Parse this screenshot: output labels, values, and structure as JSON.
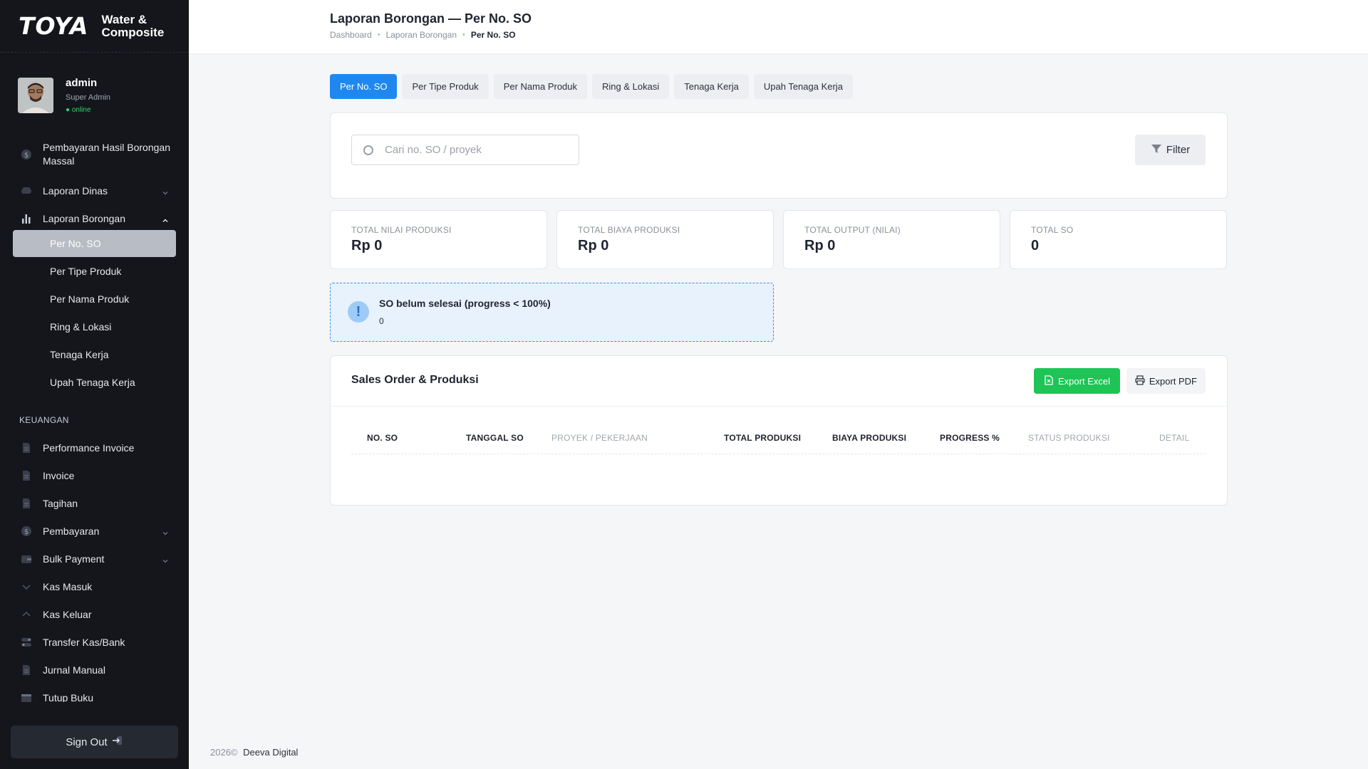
{
  "brand": {
    "logo": "TOYA",
    "subtitle_line1": "Water &",
    "subtitle_line2": "Composite"
  },
  "user": {
    "name": "admin",
    "role": "Super Admin",
    "status": "● online"
  },
  "sidebar": {
    "items": [
      {
        "label_line1": "Pembayaran Hasil Borongan",
        "label_line2": "Massal",
        "icon": "dollar-icon"
      },
      {
        "label": "Laporan Dinas",
        "icon": "car-icon",
        "chevron": "down"
      },
      {
        "label": "Laporan Borongan",
        "icon": "bar-chart-icon",
        "chevron": "up"
      }
    ],
    "sub_items": [
      "Per No. SO",
      "Per Tipe Produk",
      "Per Nama Produk",
      "Ring & Lokasi",
      "Tenaga Kerja",
      "Upah Tenaga Kerja"
    ],
    "section": "KEUANGAN",
    "finance_items": [
      {
        "label": "Performance Invoice",
        "icon": "document-icon"
      },
      {
        "label": "Invoice",
        "icon": "document-icon"
      },
      {
        "label": "Tagihan",
        "icon": "document-icon"
      },
      {
        "label": "Pembayaran",
        "icon": "dollar-icon",
        "chevron": "down"
      },
      {
        "label": "Bulk Payment",
        "icon": "wallet-icon",
        "chevron": "down"
      },
      {
        "label": "Kas Masuk",
        "icon": "arrow-down-icon"
      },
      {
        "label": "Kas Keluar",
        "icon": "arrow-up-icon"
      },
      {
        "label": "Transfer Kas/Bank",
        "icon": "transfer-icon"
      },
      {
        "label": "Jurnal Manual",
        "icon": "document-icon"
      },
      {
        "label": "Tutup Buku",
        "icon": "calendar-icon"
      }
    ],
    "signout": "Sign Out"
  },
  "header": {
    "title": "Laporan Borongan — Per No. SO",
    "breadcrumb": [
      "Dashboard",
      "Laporan Borongan",
      "Per No. SO"
    ]
  },
  "tabs": [
    "Per No. SO",
    "Per Tipe Produk",
    "Per Nama Produk",
    "Ring & Lokasi",
    "Tenaga Kerja",
    "Upah Tenaga Kerja"
  ],
  "search": {
    "placeholder": "Cari no. SO / proyek",
    "value": ""
  },
  "filter_label": "Filter",
  "stats": [
    {
      "label": "TOTAL NILAI PRODUKSI",
      "value": "Rp 0"
    },
    {
      "label": "TOTAL BIAYA PRODUKSI",
      "value": "Rp 0"
    },
    {
      "label": "TOTAL OUTPUT (NILAI)",
      "value": "Rp 0"
    },
    {
      "label": "TOTAL SO",
      "value": "0"
    }
  ],
  "alert": {
    "title": "SO belum selesai (progress < 100%)",
    "value": "0"
  },
  "table": {
    "title": "Sales Order & Produksi",
    "export_excel": "Export Excel",
    "export_pdf": "Export PDF",
    "columns": [
      "NO. SO",
      "TANGGAL SO",
      "PROYEK / PEKERJAAN",
      "TOTAL PRODUKSI",
      "BIAYA PRODUKSI",
      "PROGRESS %",
      "STATUS PRODUKSI",
      "DETAIL"
    ]
  },
  "footer": {
    "year": "2026©",
    "company": "Deeva Digital"
  },
  "colors": {
    "accent": "#1e88f0",
    "success": "#1ec456",
    "sidebar_bg": "#14161b",
    "online": "#2fd36b"
  }
}
